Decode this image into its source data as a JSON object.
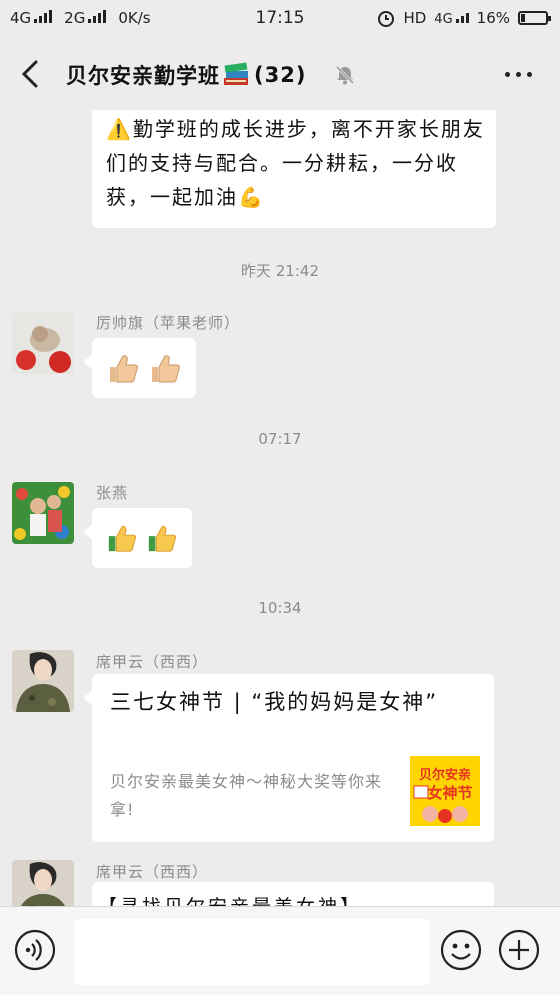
{
  "status_bar": {
    "network1": "4G",
    "network2": "2G",
    "speed": "0K/s",
    "time": "17:15",
    "hd": "HD",
    "lte": "4G",
    "battery": "16%",
    "battery_level": 0.16
  },
  "header": {
    "title": "贝尔安亲勤学班",
    "count": "(32)",
    "title_emoji": "books"
  },
  "messages": {
    "top_text": "⚠️勤学班的成长进步，离不开家长朋友们的支持与配合。一分耕耘，一分收获，一起加油💪",
    "time1": "昨天 21:42",
    "sender1": "厉帅旗（苹果老师）",
    "reply1": "👍🏼👍🏼",
    "time2": "07:17",
    "sender2": "张燕",
    "reply2": "👍👍",
    "time3": "10:34",
    "sender3": "席甲云（西西）",
    "link_title": "三七女神节 | “我的妈妈是女神”",
    "link_desc": "贝尔安亲最美女神～神秘大奖等你来拿!",
    "thumb_caption_top": "贝尔安亲",
    "thumb_caption_bottom": "女神节",
    "sender4": "席甲云（西西）",
    "partial_text": "【寻找贝尔安亲最美女神】"
  },
  "colors": {
    "background": "#ececec",
    "bubble": "#ffffff",
    "meta_text": "#8c8c8c",
    "thumb_bg": "#ffd400"
  }
}
